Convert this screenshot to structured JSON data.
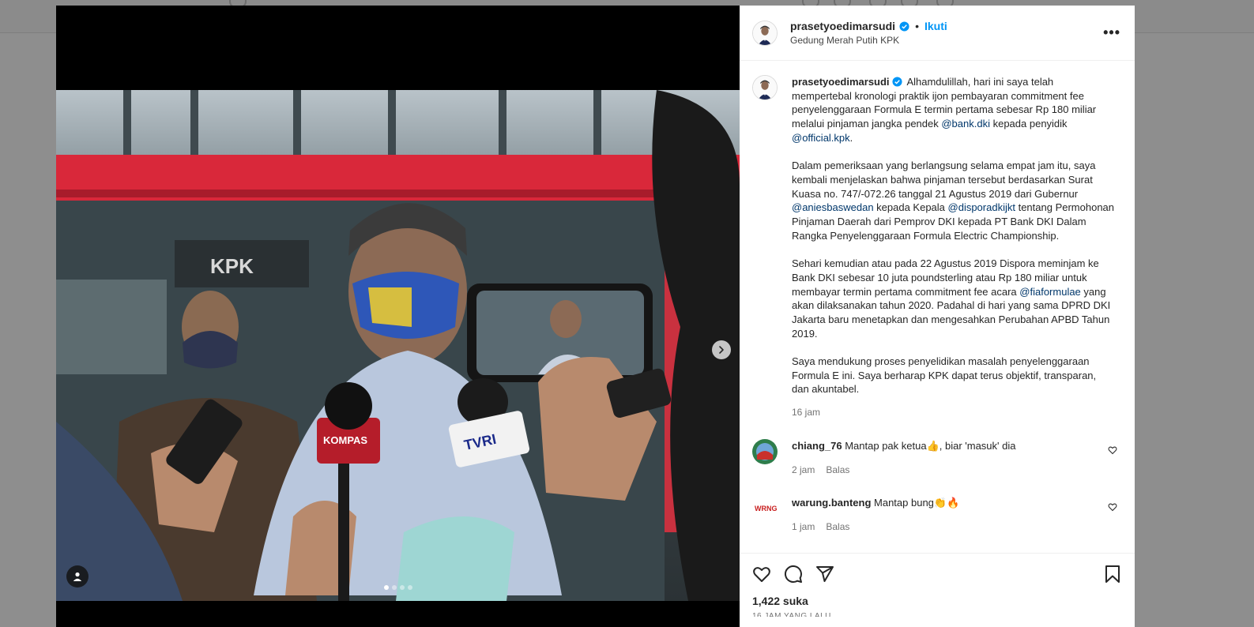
{
  "post": {
    "username": "prasetyoedimarsudi",
    "follow_label": "Ikuti",
    "separator": "•",
    "location": "Gedung Merah Putih KPK",
    "more_label": "•••",
    "caption": {
      "p1_a": "Alhamdulillah, hari ini saya telah mempertebal kronologi praktik ijon pembayaran commitment fee penyelenggaraan Formula E termin pertama sebesar Rp 180 miliar melalui pinjaman jangka pendek ",
      "p1_mention1": "@bank.dki",
      "p1_b": " kepada penyidik ",
      "p1_mention2": "@official.kpk",
      "p1_c": ".",
      "p2_a": "Dalam pemeriksaan yang berlangsung selama empat jam itu, saya kembali menjelaskan bahwa pinjaman tersebut berdasarkan Surat Kuasa no. 747/-072.26 tanggal 21 Agustus 2019 dari Gubernur ",
      "p2_mention1": "@aniesbaswedan",
      "p2_b": " kepada Kepala ",
      "p2_mention2": "@disporadkijkt",
      "p2_c": " tentang Permohonan Pinjaman Daerah dari Pemprov DKI kepada PT Bank DKI Dalam Rangka Penyelenggaraan Formula Electric Championship.",
      "p3_a": "Sehari kemudian atau pada 22 Agustus 2019 Dispora meminjam ke Bank DKI sebesar 10 juta poundsterling atau Rp 180 miliar untuk membayar termin pertama commitment fee acara ",
      "p3_mention1": "@fiaformulae",
      "p3_b": " yang akan dilaksanakan tahun 2020. Padahal di hari yang sama DPRD DKI Jakarta baru menetapkan dan mengesahkan Perubahan APBD Tahun 2019.",
      "p4": "Saya mendukung proses penyelidikan masalah penyelenggaraan Formula E ini. Saya berharap KPK dapat terus objektif, transparan, dan akuntabel."
    },
    "time_ago": "16 jam",
    "likes": "1,422 suka",
    "date_partial": "16 JAM YANG LALU"
  },
  "comments": [
    {
      "username": "chiang_76",
      "text": "Mantap pak ketua👍, biar 'masuk' dia",
      "time": "2 jam",
      "reply_label": "Balas"
    },
    {
      "username": "warung.banteng",
      "text": "Mantap bung👏🔥",
      "time": "1 jam",
      "reply_label": "Balas"
    }
  ],
  "carousel": {
    "total": 4,
    "active": 1
  },
  "icons": {
    "verified": "verified-badge-icon",
    "like": "heart-icon",
    "comment": "comment-icon",
    "share": "paper-plane-icon",
    "save": "bookmark-icon",
    "next": "chevron-right-icon",
    "tag": "user-tag-icon"
  },
  "colors": {
    "link": "#0095f6",
    "mention": "#00376b",
    "muted": "#737373"
  }
}
